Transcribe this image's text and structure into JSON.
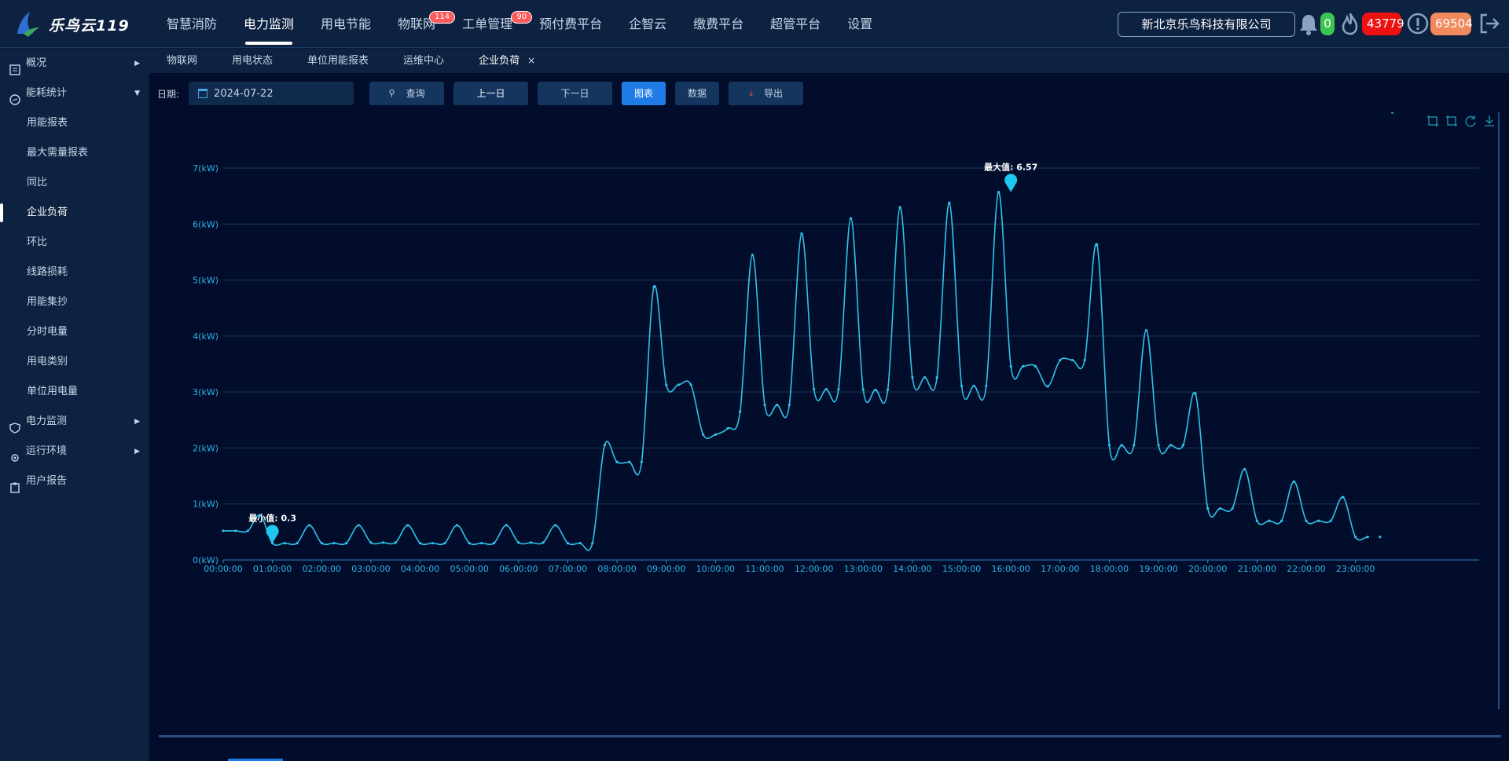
{
  "brand": {
    "name": "乐鸟云119"
  },
  "nav": [
    {
      "label": "智慧消防",
      "badge": ""
    },
    {
      "label": "电力监测",
      "badge": "",
      "active": true
    },
    {
      "label": "用电节能",
      "badge": ""
    },
    {
      "label": "物联网",
      "badge": "114"
    },
    {
      "label": "工单管理",
      "badge": "90"
    },
    {
      "label": "预付费平台",
      "badge": ""
    },
    {
      "label": "企智云",
      "badge": ""
    },
    {
      "label": "缴费平台",
      "badge": ""
    },
    {
      "label": "超管平台",
      "badge": ""
    },
    {
      "label": "设置",
      "badge": ""
    }
  ],
  "header": {
    "company": "新北京乐鸟科技有限公司",
    "bell_count": "0",
    "fire_count": "43779",
    "alert_count": "69504",
    "colors": {
      "green": "#3cc651",
      "red": "#ee1111",
      "orange": "#f08a5d"
    }
  },
  "sidebar": {
    "groups": [
      {
        "label": "概况",
        "icon": "report-icon",
        "arrow": "▶"
      },
      {
        "label": "能耗统计",
        "icon": "gauge-icon",
        "arrow": "▼"
      }
    ],
    "sub_items": [
      "用能报表",
      "最大需量报表",
      "同比",
      "企业负荷",
      "环比",
      "线路损耗",
      "用能集抄",
      "分时电量",
      "用电类别",
      "单位用电量"
    ],
    "active_sub": "企业负荷",
    "groups_after": [
      {
        "label": "电力监测",
        "icon": "shield-icon",
        "arrow": "▶"
      },
      {
        "label": "运行环境",
        "icon": "env-icon",
        "arrow": "▶"
      },
      {
        "label": "用户报告",
        "icon": "clipboard-icon",
        "arrow": ""
      }
    ]
  },
  "tabs": [
    "物联网",
    "用电状态",
    "单位用能报表",
    "运维中心",
    "企业负荷"
  ],
  "active_tab": "企业负荷",
  "tab_close": "×",
  "toolbar": {
    "date_label": "日期:",
    "date_value": "2024-07-22",
    "query": "查询",
    "prev_day": "上一日",
    "next_day": "下一日",
    "chart": "图表",
    "data": "数据",
    "export": "导出"
  },
  "chart_data": {
    "type": "line",
    "title": "",
    "xlabel": "",
    "ylabel": "",
    "y_unit": "kW",
    "ylim": [
      0,
      7
    ],
    "y_ticks": [
      "0(kW)",
      "1(kW)",
      "2(kW)",
      "3(kW)",
      "4(kW)",
      "5(kW)",
      "6(kW)",
      "7(kW)"
    ],
    "x_ticks": [
      "00:00:00",
      "01:00:00",
      "02:00:00",
      "03:00:00",
      "04:00:00",
      "05:00:00",
      "06:00:00",
      "07:00:00",
      "08:00:00",
      "09:00:00",
      "10:00:00",
      "11:00:00",
      "12:00:00",
      "13:00:00",
      "14:00:00",
      "15:00:00",
      "16:00:00",
      "17:00:00",
      "18:00:00",
      "19:00:00",
      "20:00:00",
      "21:00:00",
      "22:00:00",
      "23:00:00"
    ],
    "grid": true,
    "line_color": "#2fc3ea",
    "series": [
      {
        "x_hours": [
          0,
          0.25,
          0.5,
          0.75,
          1,
          1.25,
          1.5,
          1.75,
          2,
          2.25,
          2.5,
          2.75,
          3,
          3.25,
          3.5,
          3.75,
          4,
          4.25,
          4.5,
          4.75,
          5,
          5.25,
          5.5,
          5.75,
          6,
          6.25,
          6.5,
          6.75,
          7,
          7.25,
          7.5,
          7.75,
          8,
          8.25,
          8.5,
          8.75,
          9,
          9.25,
          9.5,
          9.75,
          10,
          10.25,
          10.5,
          10.75,
          11,
          11.25,
          11.5,
          11.75,
          12,
          12.25,
          12.5,
          12.75,
          13,
          13.25,
          13.5,
          13.75,
          14,
          14.25,
          14.5,
          14.75,
          15,
          15.25,
          15.5,
          15.75,
          16,
          16.25,
          16.5,
          16.75,
          17,
          17.25,
          17.5,
          17.75,
          18,
          18.25,
          18.5,
          18.75,
          19,
          19.25,
          19.5,
          19.75,
          20,
          20.25,
          20.5,
          20.75,
          21,
          21.25,
          21.5,
          21.75,
          22,
          22.25,
          22.5,
          22.75,
          23,
          23.25,
          23.5,
          23.75
        ],
        "values": [
          0.52,
          0.52,
          0.52,
          0.8,
          0.3,
          0.3,
          0.3,
          0.62,
          0.3,
          0.3,
          0.3,
          0.62,
          0.31,
          0.31,
          0.31,
          0.62,
          0.3,
          0.3,
          0.3,
          0.62,
          0.3,
          0.3,
          0.3,
          0.62,
          0.31,
          0.31,
          0.31,
          0.62,
          0.3,
          0.3,
          0.3,
          2.05,
          1.75,
          1.75,
          1.75,
          4.88,
          3.13,
          3.13,
          3.13,
          2.24,
          2.24,
          2.35,
          2.65,
          5.45,
          2.77,
          2.77,
          2.77,
          5.83,
          3.05,
          3.05,
          3.05,
          6.1,
          3.04,
          3.04,
          3.04,
          6.3,
          3.26,
          3.26,
          3.26,
          6.38,
          3.11,
          3.11,
          3.11,
          6.57,
          3.46,
          3.46,
          3.46,
          3.1,
          3.57,
          3.57,
          3.57,
          5.63,
          2.05,
          2.05,
          2.05,
          4.1,
          2.05,
          2.05,
          2.05,
          2.97,
          0.92,
          0.92,
          0.92,
          1.62,
          0.7,
          0.7,
          0.7,
          1.4,
          0.7,
          0.7,
          0.7,
          1.12,
          0.41,
          0.41,
          0.41
        ]
      }
    ],
    "markers": [
      {
        "label": "最大值: 6.57",
        "x_hour": 16.0,
        "value": 6.57
      },
      {
        "label": "最小值: 0.3",
        "x_hour": 1.0,
        "value": 0.3
      }
    ]
  }
}
